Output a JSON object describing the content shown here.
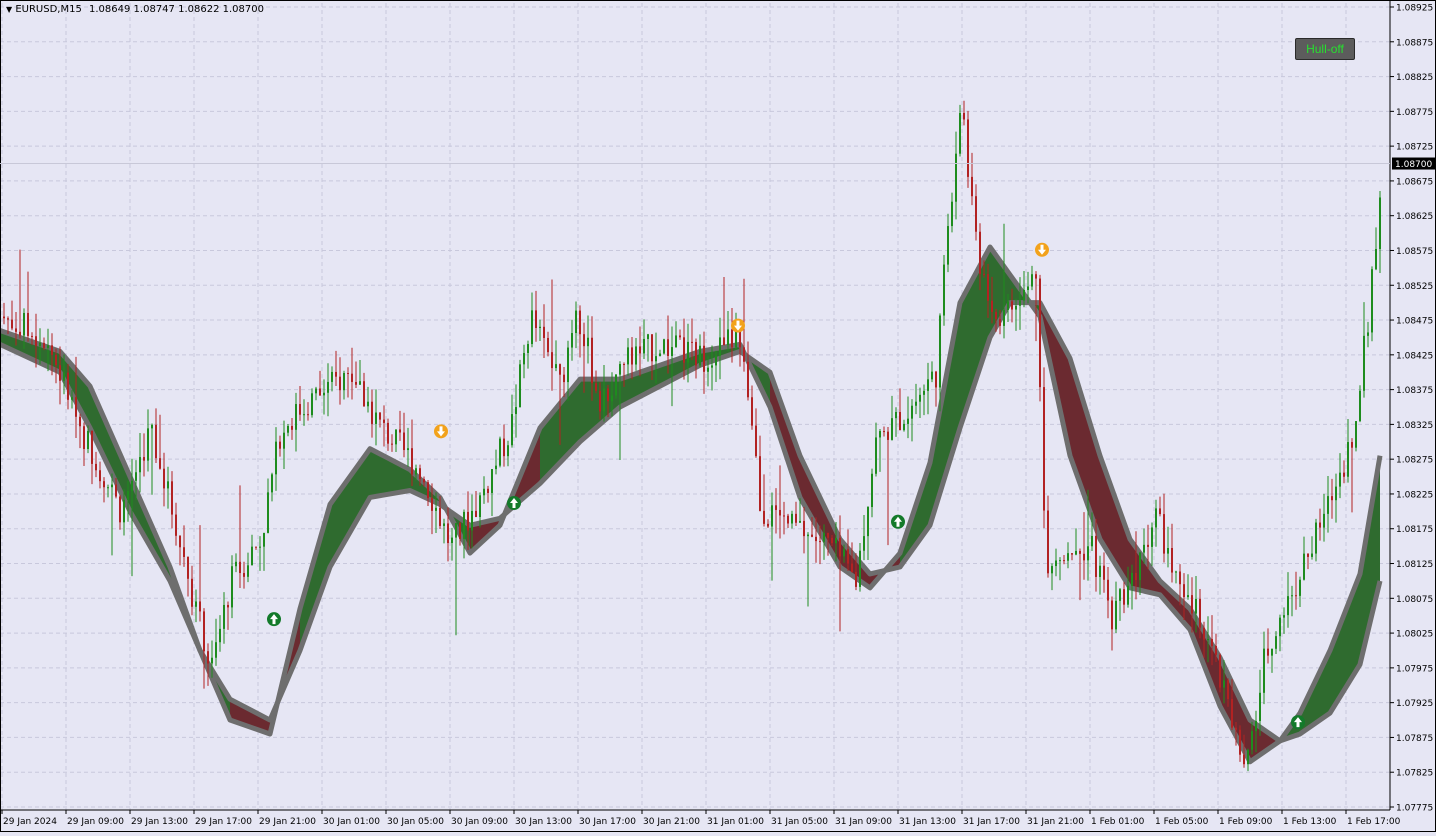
{
  "header": {
    "menu_icon": "triangle-down-icon",
    "symbol": "EURUSD,M15",
    "ohlc": "1.08649 1.08747 1.08622 1.08700"
  },
  "hull_button": {
    "label": "Hull-off",
    "text_color": "#27e02f"
  },
  "price_axis": {
    "labels": [
      "1.08925",
      "1.08875",
      "1.08825",
      "1.08775",
      "1.08725",
      "1.08675",
      "1.08625",
      "1.08575",
      "1.08525",
      "1.08475",
      "1.08425",
      "1.08375",
      "1.08325",
      "1.08275",
      "1.08225",
      "1.08175",
      "1.08125",
      "1.08075",
      "1.08025",
      "1.07975",
      "1.07925",
      "1.07875",
      "1.07825",
      "1.07775"
    ],
    "current_price": "1.08700"
  },
  "time_axis": {
    "labels": [
      "29 Jan 2024",
      "29 Jan 09:00",
      "29 Jan 13:00",
      "29 Jan 17:00",
      "29 Jan 21:00",
      "30 Jan 01:00",
      "30 Jan 05:00",
      "30 Jan 09:00",
      "30 Jan 13:00",
      "30 Jan 17:00",
      "30 Jan 21:00",
      "31 Jan 01:00",
      "31 Jan 05:00",
      "31 Jan 09:00",
      "31 Jan 13:00",
      "31 Jan 17:00",
      "31 Jan 21:00",
      "1 Feb 01:00",
      "1 Feb 05:00",
      "1 Feb 09:00",
      "1 Feb 13:00",
      "1 Feb 17:00"
    ]
  },
  "colors": {
    "background": "#e6e6f4",
    "bull_candle": "#1e8c1e",
    "bear_candle": "#b22222",
    "bull_band": "#2f6b2f",
    "bear_band": "#6b2a30",
    "band_border": "#6e6e6e",
    "grid": "#c8c8dc",
    "up_arrow": "#137a2a",
    "down_arrow": "#f2a21b"
  },
  "chart_data": {
    "type": "candlestick",
    "symbol": "EURUSD",
    "timeframe": "M15",
    "ylim": [
      1.0775,
      1.0895
    ],
    "last_close": 1.087,
    "path_points": [
      [
        0,
        1.0848
      ],
      [
        45,
        1.0845
      ],
      [
        80,
        1.0832
      ],
      [
        120,
        1.082
      ],
      [
        150,
        1.0832
      ],
      [
        175,
        1.0818
      ],
      [
        210,
        1.0797
      ],
      [
        230,
        1.081
      ],
      [
        260,
        1.0816
      ],
      [
        280,
        1.0832
      ],
      [
        310,
        1.0836
      ],
      [
        350,
        1.084
      ],
      [
        380,
        1.0832
      ],
      [
        420,
        1.0826
      ],
      [
        450,
        1.0815
      ],
      [
        480,
        1.0822
      ],
      [
        510,
        1.0832
      ],
      [
        530,
        1.0848
      ],
      [
        560,
        1.0838
      ],
      [
        575,
        1.085
      ],
      [
        600,
        1.0835
      ],
      [
        625,
        1.0842
      ],
      [
        660,
        1.0844
      ],
      [
        700,
        1.0842
      ],
      [
        735,
        1.0845
      ],
      [
        750,
        1.0835
      ],
      [
        760,
        1.082
      ],
      [
        790,
        1.0818
      ],
      [
        830,
        1.0815
      ],
      [
        855,
        1.081
      ],
      [
        875,
        1.083
      ],
      [
        910,
        1.0835
      ],
      [
        935,
        1.084
      ],
      [
        948,
        1.0862
      ],
      [
        960,
        1.088
      ],
      [
        975,
        1.0858
      ],
      [
        995,
        1.0848
      ],
      [
        1020,
        1.085
      ],
      [
        1036,
        1.0855
      ],
      [
        1045,
        1.081
      ],
      [
        1065,
        1.0815
      ],
      [
        1090,
        1.0815
      ],
      [
        1110,
        1.0805
      ],
      [
        1135,
        1.0812
      ],
      [
        1155,
        1.082
      ],
      [
        1180,
        1.0807
      ],
      [
        1200,
        1.0805
      ],
      [
        1230,
        1.079
      ],
      [
        1245,
        1.0782
      ],
      [
        1265,
        1.08
      ],
      [
        1290,
        1.0808
      ],
      [
        1320,
        1.0818
      ],
      [
        1350,
        1.083
      ],
      [
        1365,
        1.0845
      ],
      [
        1382,
        1.087
      ]
    ],
    "hull_band": {
      "fast": [
        [
          0,
          1.0846
        ],
        [
          60,
          1.0843
        ],
        [
          90,
          1.0838
        ],
        [
          130,
          1.0825
        ],
        [
          170,
          1.0812
        ],
        [
          200,
          1.08
        ],
        [
          230,
          1.079
        ],
        [
          270,
          1.0788
        ],
        [
          300,
          1.0806
        ],
        [
          330,
          1.0821
        ],
        [
          370,
          1.0829
        ],
        [
          410,
          1.0826
        ],
        [
          440,
          1.0822
        ],
        [
          470,
          1.0814
        ],
        [
          500,
          1.0818
        ],
        [
          540,
          1.0832
        ],
        [
          580,
          1.0839
        ],
        [
          620,
          1.0839
        ],
        [
          660,
          1.0841
        ],
        [
          700,
          1.0843
        ],
        [
          740,
          1.0844
        ],
        [
          770,
          1.0835
        ],
        [
          800,
          1.0822
        ],
        [
          840,
          1.0812
        ],
        [
          870,
          1.0809
        ],
        [
          900,
          1.0814
        ],
        [
          930,
          1.0827
        ],
        [
          960,
          1.085
        ],
        [
          990,
          1.0858
        ],
        [
          1010,
          1.0854
        ],
        [
          1040,
          1.0848
        ],
        [
          1070,
          1.0828
        ],
        [
          1100,
          1.0816
        ],
        [
          1130,
          1.0809
        ],
        [
          1160,
          1.0808
        ],
        [
          1190,
          1.0803
        ],
        [
          1220,
          1.0792
        ],
        [
          1250,
          1.0784
        ],
        [
          1280,
          1.0787
        ],
        [
          1300,
          1.0791
        ],
        [
          1330,
          1.08
        ],
        [
          1360,
          1.0811
        ],
        [
          1380,
          1.0828
        ]
      ],
      "slow": [
        [
          0,
          1.0844
        ],
        [
          60,
          1.084
        ],
        [
          90,
          1.0832
        ],
        [
          130,
          1.082
        ],
        [
          170,
          1.081
        ],
        [
          200,
          1.08
        ],
        [
          230,
          1.0793
        ],
        [
          270,
          1.079
        ],
        [
          300,
          1.08
        ],
        [
          330,
          1.0812
        ],
        [
          370,
          1.0822
        ],
        [
          410,
          1.0823
        ],
        [
          440,
          1.0821
        ],
        [
          470,
          1.0818
        ],
        [
          500,
          1.0819
        ],
        [
          540,
          1.0824
        ],
        [
          580,
          1.083
        ],
        [
          620,
          1.0835
        ],
        [
          660,
          1.0838
        ],
        [
          700,
          1.0841
        ],
        [
          740,
          1.0843
        ],
        [
          770,
          1.084
        ],
        [
          800,
          1.0828
        ],
        [
          840,
          1.0816
        ],
        [
          870,
          1.0811
        ],
        [
          900,
          1.0812
        ],
        [
          930,
          1.0818
        ],
        [
          960,
          1.0832
        ],
        [
          990,
          1.0845
        ],
        [
          1010,
          1.085
        ],
        [
          1040,
          1.085
        ],
        [
          1070,
          1.0842
        ],
        [
          1100,
          1.0828
        ],
        [
          1130,
          1.0816
        ],
        [
          1160,
          1.081
        ],
        [
          1190,
          1.0806
        ],
        [
          1220,
          1.0799
        ],
        [
          1250,
          1.079
        ],
        [
          1280,
          1.0787
        ],
        [
          1300,
          1.0788
        ],
        [
          1330,
          1.0791
        ],
        [
          1360,
          1.0798
        ],
        [
          1380,
          1.081
        ]
      ]
    },
    "signals": [
      {
        "type": "buy",
        "x": 274,
        "price": 1.08045
      },
      {
        "type": "sell",
        "x": 441,
        "price": 1.08315
      },
      {
        "type": "buy",
        "x": 514,
        "price": 1.08212
      },
      {
        "type": "sell",
        "x": 738,
        "price": 1.08467
      },
      {
        "type": "buy",
        "x": 898,
        "price": 1.08185
      },
      {
        "type": "sell",
        "x": 1042,
        "price": 1.08576
      },
      {
        "type": "buy",
        "x": 1298,
        "price": 1.07897
      }
    ]
  }
}
